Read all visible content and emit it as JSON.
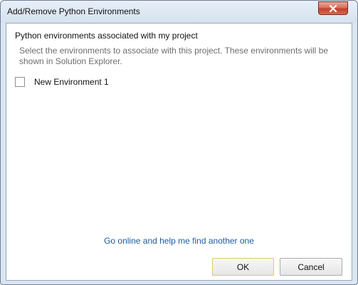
{
  "window": {
    "title": "Add/Remove Python Environments",
    "close_icon": "close-icon"
  },
  "content": {
    "heading": "Python environments associated with my project",
    "description": "Select the environments to associate with this project. These environments will be shown in Solution Explorer.",
    "environments": [
      {
        "label": "New Environment 1",
        "checked": false
      }
    ],
    "link_text": "Go online and help me find another one"
  },
  "buttons": {
    "ok_label": "OK",
    "cancel_label": "Cancel"
  },
  "colors": {
    "link": "#1a5da6",
    "close_button": "#c1412a",
    "ok_border": "#e5c365"
  }
}
